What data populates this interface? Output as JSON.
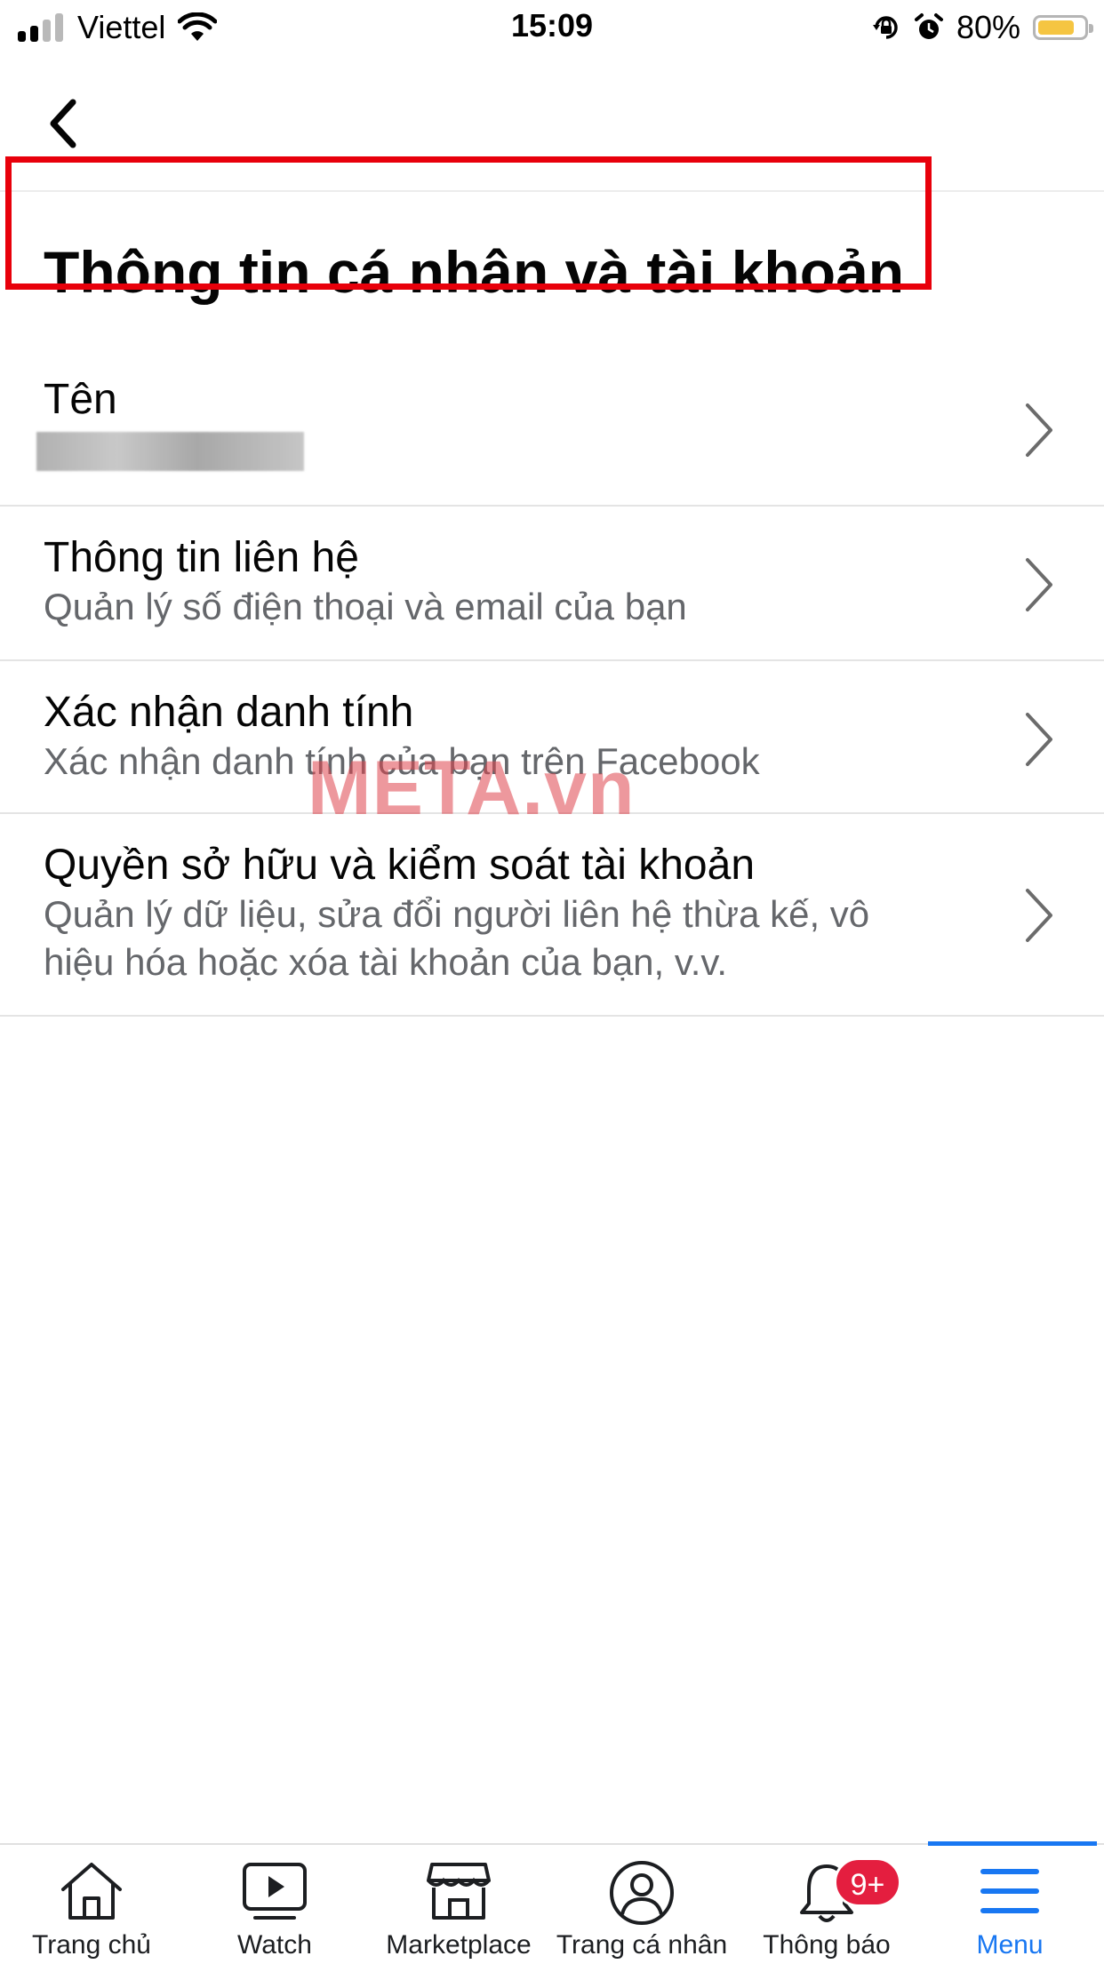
{
  "status_bar": {
    "carrier": "Viettel",
    "time": "15:09",
    "battery_percent": "80%",
    "battery_level": 0.8,
    "icons": [
      "signal-icon",
      "wifi-icon",
      "rotation-lock-icon",
      "alarm-icon",
      "battery-icon"
    ]
  },
  "header": {
    "back_icon": "chevron-left-icon"
  },
  "page": {
    "title": "Thông tin cá nhân và tài khoản"
  },
  "rows": [
    {
      "label": "Tên",
      "value_blurred": true
    },
    {
      "label": "Thông tin liên hệ",
      "sub": "Quản lý số điện thoại và email của bạn",
      "highlighted": true,
      "highlight_color": "#e8000b"
    },
    {
      "label": "Xác nhận danh tính",
      "sub": "Xác nhận danh tính của bạn trên Facebook"
    },
    {
      "label": "Quyền sở hữu và kiểm soát tài khoản",
      "sub": "Quản lý dữ liệu, sửa đổi người liên hệ thừa kế, vô hiệu hóa hoặc xóa tài khoản của bạn, v.v."
    }
  ],
  "watermark": "META.vn",
  "bottom_nav": {
    "items": [
      {
        "label": "Trang chủ",
        "icon": "home-icon"
      },
      {
        "label": "Watch",
        "icon": "watch-video-icon"
      },
      {
        "label": "Marketplace",
        "icon": "marketplace-store-icon"
      },
      {
        "label": "Trang cá nhân",
        "icon": "profile-icon"
      },
      {
        "label": "Thông báo",
        "icon": "bell-icon"
      },
      {
        "label": "Menu",
        "icon": "menu-icon",
        "active": true
      }
    ],
    "notification_badge": "9+"
  },
  "colors": {
    "accent": "#1877f2",
    "badge": "#e41e3f",
    "secondary_text": "#65676b",
    "battery": "#f5c542"
  }
}
